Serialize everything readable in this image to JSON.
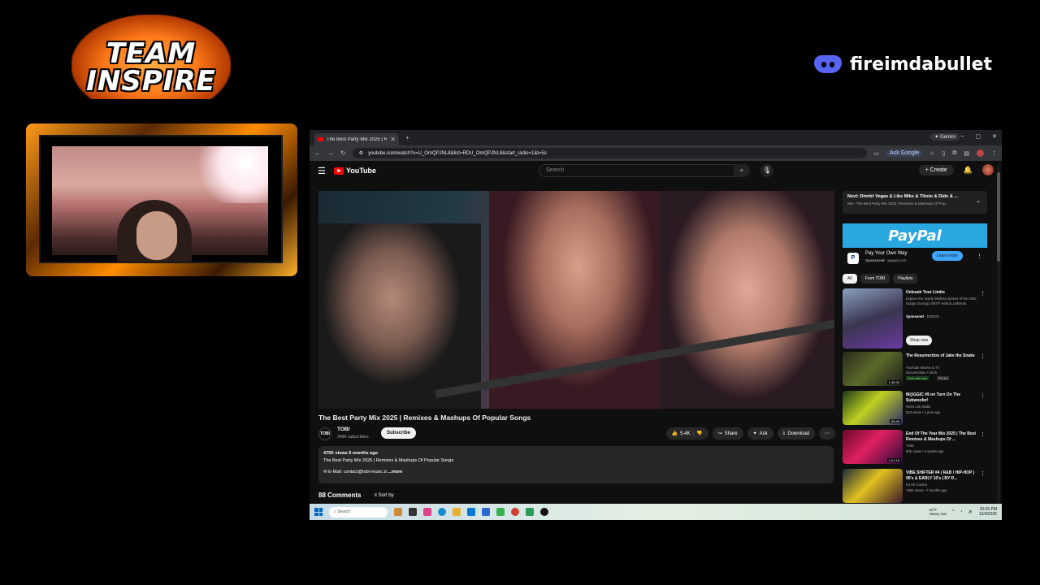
{
  "overlay": {
    "team_logo_line1": "TEAM",
    "team_logo_line2": "INSPIRE",
    "discord_name": "fireimdabullet"
  },
  "browser": {
    "tab_title": "The Best Party Mix 2025 | R",
    "gemini_label": "Gemini",
    "url": "youtube.com/watch?v=U_OmQPJNL8&list=RDU_OmQPJNL8&start_radio=1&t=5s",
    "ask_google": "Ask Google"
  },
  "youtube": {
    "logo_text": "YouTube",
    "search_placeholder": "Search",
    "create_label": "Create",
    "video": {
      "title": "The Best Party Mix 2025 | Remixes & Mashups Of Popular Songs",
      "channel_avatar_text": "TOBI",
      "channel": "TOBI",
      "subscribers": "349K subscribers",
      "subscribe_label": "Subscribe",
      "likes": "5.4K",
      "share_label": "Share",
      "ask_label": "Ask",
      "download_label": "Download",
      "views_age": "475K views  9 months ago",
      "description": "The Best Party Mix 2025 | Remixes & Mashups Of Popular Songs",
      "email_line": "E-Mail: contact@tobi-music.d",
      "more_label": "...more",
      "comments_count": "88 Comments",
      "sort_by": "Sort by"
    },
    "sidebar": {
      "next_title": "Next: Dimitri Vegas & Like Mike & Tiësto & Dido & ...",
      "next_sub": "Mix - The Best Party Mix 2025 | Remixes & Mashups Of Pop...",
      "ad": {
        "brand_banner": "PayPal",
        "logo_text": "P",
        "title": "Pay Your Own Way",
        "sponsored": "Sponsored",
        "domain": "paypal.com",
        "cta": "Learn more"
      },
      "chips": [
        "All",
        "From TOBI",
        "Playlists"
      ],
      "recommendations": [
        {
          "title": "Unleash Your Limits",
          "desc": "Explore the nearly limitless options of the 2026 Dodge Durango SRT® Hellcat Jailbreak.",
          "sponsored": "Sponsored",
          "advertiser": "DODGE",
          "cta": "Shop now"
        },
        {
          "title": "The Resurrection of Jake the Snake",
          "channel": "YouTube Movies & TV",
          "meta": "Documentary • 2016",
          "badge1": "Free with ads",
          "badge2": "TV-14",
          "duration": "1:36:35"
        },
        {
          "title": "M@GGIC #9 on Turn On The Subwoofer!",
          "channel": "Retro Life Radio",
          "meta": "523 views • 1 year ago",
          "duration": "59:49"
        },
        {
          "title": "End Of The Year Mix 2025 | The Best Remixes & Mashups Of ...",
          "channel": "TOBI",
          "meta": "60K views • 4 weeks ago",
          "duration": "1:01:18"
        },
        {
          "title": "VIBE SHIFTER #4 | R&B / HIP-HOP | 00's & EARLY 10's | BY D...",
          "channel": "DJ Hit Combo",
          "meta": "796K views • 7 months ago",
          "duration": ""
        }
      ]
    }
  },
  "taskbar": {
    "search_placeholder": "Search",
    "weather_temp": "62°F",
    "weather_desc": "Heavy rain",
    "time": "10:26 PM",
    "date": "12/4/2025"
  },
  "colors": {
    "youtube_bg": "#0f0f0f",
    "youtube_red": "#ff0000",
    "discord_blurple": "#5865f2",
    "paypal_blue": "#29a8e0"
  }
}
